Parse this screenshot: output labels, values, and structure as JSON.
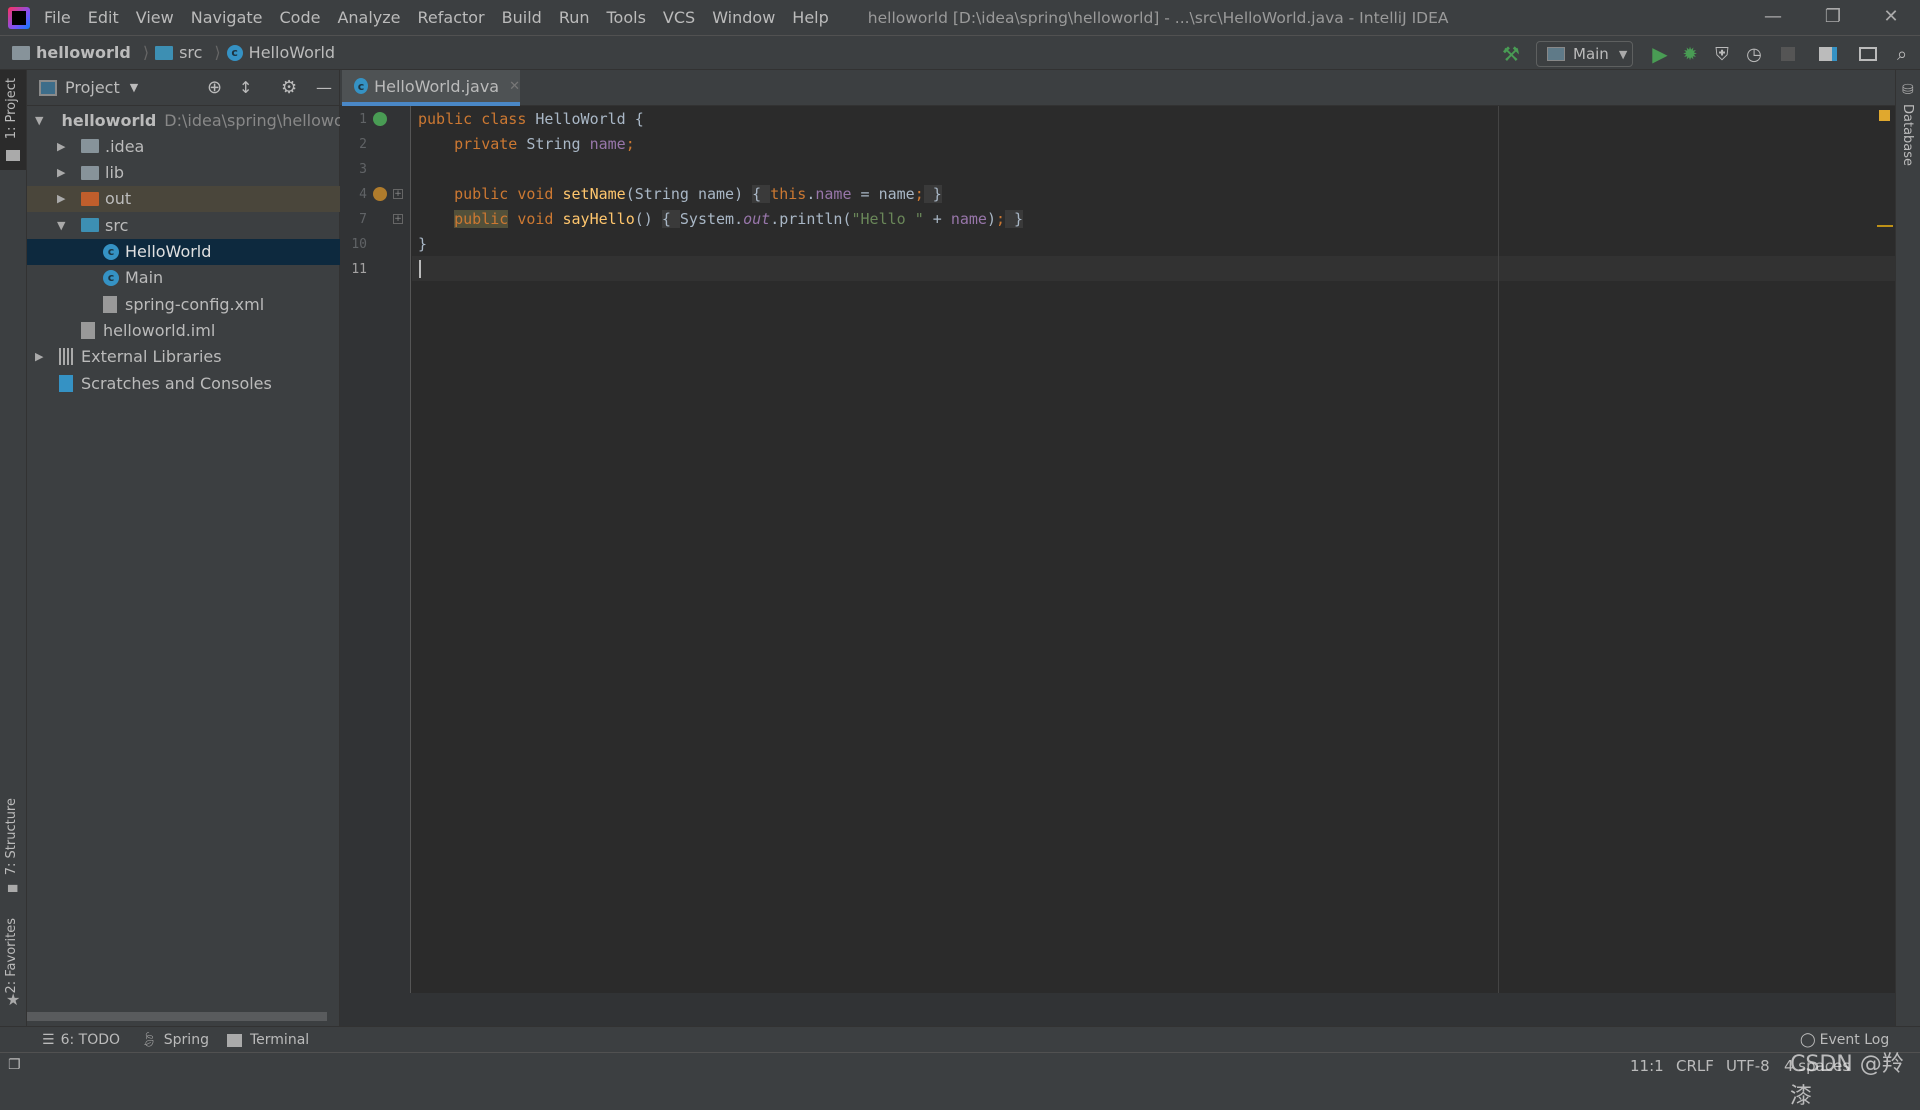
{
  "menu": [
    "File",
    "Edit",
    "View",
    "Navigate",
    "Code",
    "Analyze",
    "Refactor",
    "Build",
    "Run",
    "Tools",
    "VCS",
    "Window",
    "Help"
  ],
  "window_title": "helloworld [D:\\idea\\spring\\helloworld] - ...\\src\\HelloWorld.java - IntelliJ IDEA",
  "breadcrumb": [
    "helloworld",
    "src",
    "HelloWorld"
  ],
  "run_config": "Main",
  "project_panel": {
    "title": "Project",
    "tree": [
      {
        "label": "helloworld",
        "path": "D:\\idea\\spring\\helloworld",
        "depth": 0,
        "arrow": "open",
        "icon": "module-folder-icon"
      },
      {
        "label": ".idea",
        "depth": 1,
        "arrow": "closed",
        "icon": "folder-icon"
      },
      {
        "label": "lib",
        "depth": 1,
        "arrow": "closed",
        "icon": "folder-icon"
      },
      {
        "label": "out",
        "depth": 1,
        "arrow": "closed",
        "icon": "excluded-folder-icon",
        "highlight": "excluded"
      },
      {
        "label": "src",
        "depth": 1,
        "arrow": "open",
        "icon": "source-folder-icon"
      },
      {
        "label": "HelloWorld",
        "depth": 2,
        "icon": "class-icon",
        "selected": true
      },
      {
        "label": "Main",
        "depth": 2,
        "icon": "runnable-class-icon"
      },
      {
        "label": "spring-config.xml",
        "depth": 2,
        "icon": "spring-xml-icon"
      },
      {
        "label": "helloworld.iml",
        "depth": 1,
        "icon": "iml-file-icon"
      },
      {
        "label": "External Libraries",
        "depth": 0,
        "arrow": "closed",
        "icon": "libraries-icon"
      },
      {
        "label": "Scratches and Consoles",
        "depth": 0,
        "icon": "scratches-icon"
      }
    ]
  },
  "left_stripe": {
    "project": "1: Project",
    "structure": "7: Structure",
    "favorites": "2: Favorites"
  },
  "right_stripe": {
    "database": "Database"
  },
  "editor": {
    "tab": "HelloWorld.java",
    "lines": [
      {
        "num": "1",
        "tokens": [
          [
            "public ",
            "kw"
          ],
          [
            "class ",
            "kw"
          ],
          [
            "HelloWorld {",
            ""
          ]
        ]
      },
      {
        "num": "2",
        "tokens": [
          [
            "    ",
            ""
          ],
          [
            "private ",
            "kw"
          ],
          [
            "String ",
            ""
          ],
          [
            "name",
            "fd"
          ],
          [
            ";",
            "kw"
          ]
        ]
      },
      {
        "num": "3",
        "tokens": []
      },
      {
        "num": "4",
        "tokens": [
          [
            "    ",
            ""
          ],
          [
            "public ",
            "kw"
          ],
          [
            "void ",
            "kw"
          ],
          [
            "setName",
            "fn"
          ],
          [
            "(String name) ",
            ""
          ],
          [
            "{ ",
            "fb"
          ],
          [
            "this",
            "kw"
          ],
          [
            ".",
            ""
          ],
          [
            "name",
            "fd"
          ],
          [
            " = name",
            ""
          ],
          [
            ";",
            "kw"
          ],
          [
            " }",
            "fb"
          ]
        ]
      },
      {
        "num": "7",
        "tokens": [
          [
            "    ",
            ""
          ],
          [
            "public",
            "kw hl"
          ],
          [
            " ",
            ""
          ],
          [
            "void ",
            "kw"
          ],
          [
            "sayHello",
            "fn"
          ],
          [
            "() ",
            ""
          ],
          [
            "{ ",
            "fb"
          ],
          [
            "System.",
            ""
          ],
          [
            "out",
            "it"
          ],
          [
            ".println(",
            ""
          ],
          [
            "\"Hello \"",
            "st"
          ],
          [
            " + ",
            ""
          ],
          [
            "name",
            "fd"
          ],
          [
            ")",
            ""
          ],
          [
            ";",
            "kw"
          ],
          [
            " }",
            "fb"
          ]
        ]
      },
      {
        "num": "10",
        "tokens": [
          [
            "}",
            ""
          ]
        ]
      },
      {
        "num": "11",
        "tokens": []
      }
    ]
  },
  "bottom_tools": [
    "6: TODO",
    "Spring",
    "Terminal"
  ],
  "event_log": "Event Log",
  "status": {
    "position": "11:1",
    "line_sep": "CRLF",
    "encoding": "UTF-8",
    "indent": "4 spaces"
  },
  "watermark": "CSDN @羚漆",
  "colors": {
    "keyword": "#cc7832",
    "field": "#9876aa",
    "string": "#6a8759",
    "text": "#a9b7c6",
    "accent": "#4a88c7",
    "run": "#499c54"
  }
}
